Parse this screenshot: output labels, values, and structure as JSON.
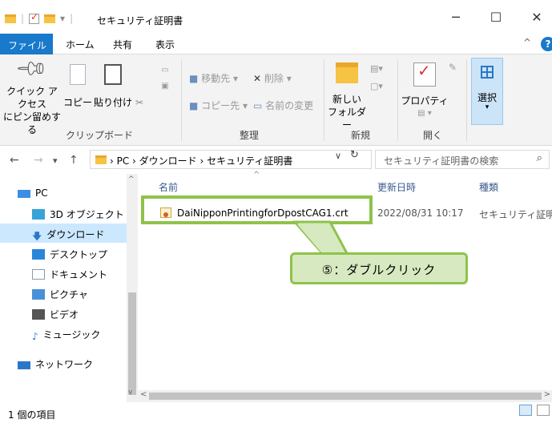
{
  "window": {
    "title": "セキュリティ証明書",
    "qat_dropdown": "▾",
    "minimize": "─",
    "maximize": "☐",
    "close": "✕"
  },
  "ribbon_tabs": {
    "file": "ファイル",
    "home": "ホーム",
    "share": "共有",
    "view": "表示",
    "help": "?"
  },
  "ribbon": {
    "pin_label_1": "クイック アクセス",
    "pin_label_2": "にピン留めする",
    "copy": "コピー",
    "paste": "貼り付け",
    "cut_icon": "✂",
    "clipboard_group": "クリップボード",
    "move_to": "移動先 ▾",
    "copy_to": "コピー先 ▾",
    "delete": "削除 ▾",
    "rename": "名前の変更",
    "organize_group": "整理",
    "new_folder_1": "新しい",
    "new_folder_2": "フォルダー",
    "new_group": "新規",
    "properties": "プロパティ",
    "open_group": "開く",
    "select": "選択",
    "select_caret": "▾"
  },
  "address": {
    "back": "←",
    "forward": "→",
    "recent": "▾",
    "up": "↑",
    "path": "›  PC  ›  ダウンロード  ›  セキュリティ証明書",
    "dropdown": "∨",
    "refresh": "↻",
    "search_placeholder": "セキュリティ証明書の検索",
    "search_icon": "⌕"
  },
  "nav_pane": {
    "items": [
      {
        "label": "PC",
        "color": "#3a8ee6"
      },
      {
        "label": "3D オブジェクト",
        "color": "#36a3d9"
      },
      {
        "label": "ダウンロード",
        "color": "#2a77c9"
      },
      {
        "label": "デスクトップ",
        "color": "#2a86d9"
      },
      {
        "label": "ドキュメント",
        "color": "#8a9bb0"
      },
      {
        "label": "ピクチャ",
        "color": "#4a90d9"
      },
      {
        "label": "ビデオ",
        "color": "#555"
      },
      {
        "label": "ミュージック",
        "color": "#2a77c9"
      },
      {
        "label": "ネットワーク",
        "color": "#2a77c9"
      }
    ]
  },
  "columns": {
    "name": "名前",
    "date": "更新日時",
    "type": "種類"
  },
  "files": [
    {
      "name": "DaiNipponPrintingforDpostCAG1.crt",
      "date": "2022/08/31 10:17",
      "type": "セキュリティ証明書"
    }
  ],
  "annotation": {
    "callout": "⑤：ダブルクリック",
    "color": "#8ec34b"
  },
  "status": {
    "count": "1 個の項目"
  }
}
